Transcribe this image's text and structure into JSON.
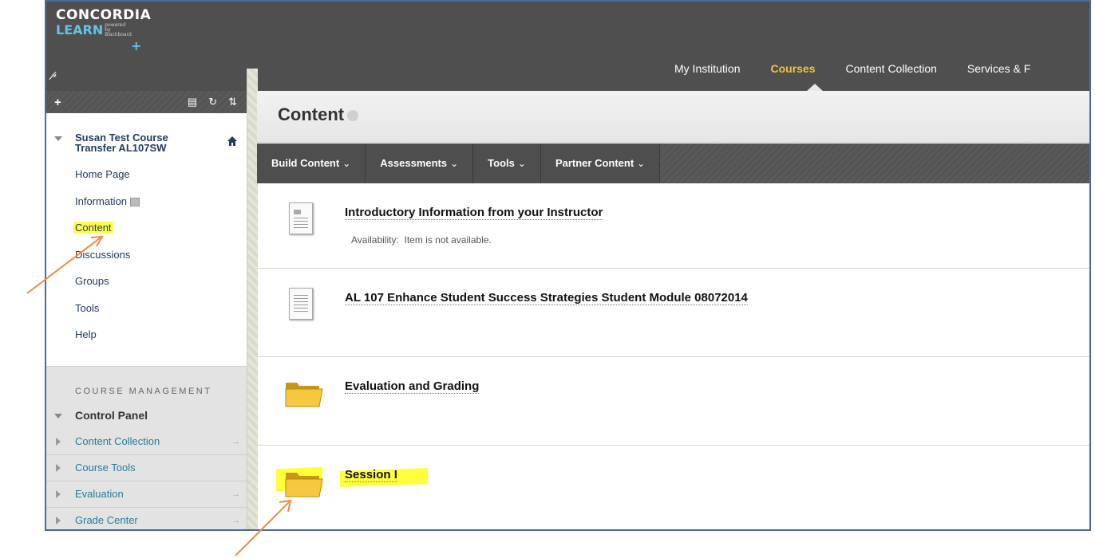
{
  "logo": {
    "line1": "CONCORDIA",
    "line2": "LEARN",
    "powered": "powered by Blackboard",
    "plus": "+"
  },
  "topnav": [
    "My Institution",
    "Courses",
    "Content Collection",
    "Services & F"
  ],
  "sidebar": {
    "course_title": "Susan Test Course Transfer AL107SW",
    "items": [
      "Home Page",
      "Information",
      "Content",
      "Discussions",
      "Groups",
      "Tools",
      "Help"
    ],
    "management_header": "COURSE MANAGEMENT",
    "control_panel": "Control Panel",
    "panel_items": [
      "Content Collection",
      "Course Tools",
      "Evaluation",
      "Grade Center"
    ]
  },
  "page": {
    "title": "Content",
    "actions": [
      "Build Content",
      "Assessments",
      "Tools",
      "Partner Content"
    ]
  },
  "content_items": [
    {
      "title": "Introductory Information from your Instructor",
      "detail_label": "Availability:",
      "detail_value": "Item is not available.",
      "icon": "document-icon"
    },
    {
      "title": "AL 107 Enhance Student Success Strategies Student Module 08072014",
      "icon": "document-icon"
    },
    {
      "title": "Evaluation and Grading",
      "icon": "folder-icon"
    },
    {
      "title": "Session I",
      "icon": "folder-icon"
    }
  ],
  "colors": {
    "header": "#4f4f4f",
    "active_nav": "#f3c33a",
    "highlight": "#ffff4a",
    "annotation_arrow": "#f08a3c"
  }
}
